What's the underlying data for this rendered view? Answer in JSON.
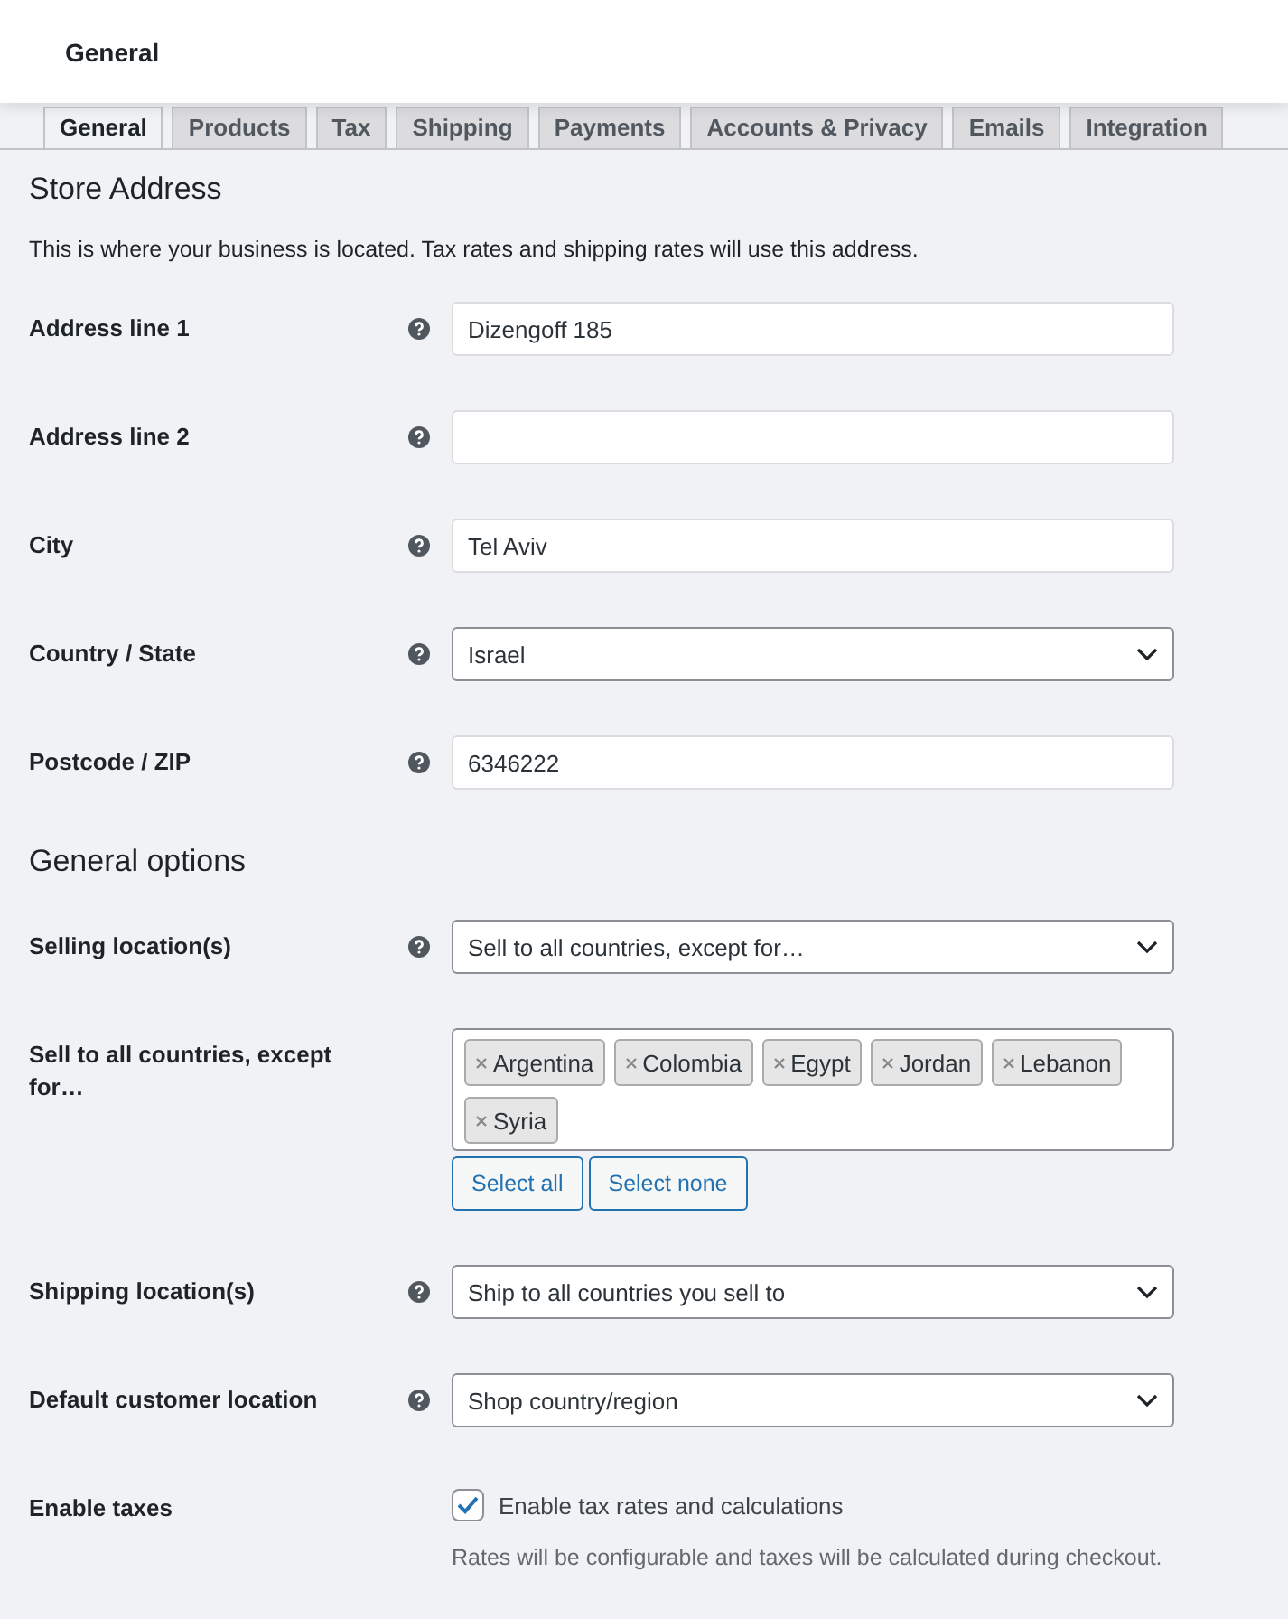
{
  "header": {
    "title": "General"
  },
  "tabs": [
    {
      "label": "General",
      "selected": true
    },
    {
      "label": "Products",
      "selected": false
    },
    {
      "label": "Tax",
      "selected": false
    },
    {
      "label": "Shipping",
      "selected": false
    },
    {
      "label": "Payments",
      "selected": false
    },
    {
      "label": "Accounts & Privacy",
      "selected": false
    },
    {
      "label": "Emails",
      "selected": false
    },
    {
      "label": "Integration",
      "selected": false
    }
  ],
  "sections": [
    {
      "title": "Store Address",
      "description": "This is where your business is located. Tax rates and shipping rates will use this address.",
      "fields": [
        {
          "kind": "text",
          "label": "Address line 1",
          "help": true,
          "value": "Dizengoff 185"
        },
        {
          "kind": "text",
          "label": "Address line 2",
          "help": true
        },
        {
          "kind": "text",
          "label": "City",
          "help": true,
          "value": "Tel Aviv"
        },
        {
          "kind": "select",
          "label": "Country / State",
          "help": true,
          "value": "Israel"
        },
        {
          "kind": "text",
          "label": "Postcode / ZIP",
          "help": true,
          "value": "6346222"
        }
      ]
    },
    {
      "title": "General options",
      "fields": [
        {
          "kind": "select",
          "label": "Selling location(s)",
          "help": true,
          "value": "Sell to all countries, except for…"
        },
        {
          "kind": "multiselect",
          "label": "Sell to all countries, except for…",
          "help": false,
          "tags": [
            "Argentina",
            "Colombia",
            "Egypt",
            "Jordan",
            "Lebanon",
            "Syria"
          ],
          "buttons": [
            "Select all",
            "Select none"
          ]
        },
        {
          "kind": "select",
          "label": "Shipping location(s)",
          "help": true,
          "value": "Ship to all countries you sell to"
        },
        {
          "kind": "select",
          "label": "Default customer location",
          "help": true,
          "value": "Shop country/region"
        },
        {
          "kind": "checkbox",
          "label": "Enable taxes",
          "help": false,
          "checked": true,
          "option": "Enable tax rates and calculations",
          "note": "Rates will be configurable and taxes will be calculated during checkout."
        }
      ]
    }
  ]
}
